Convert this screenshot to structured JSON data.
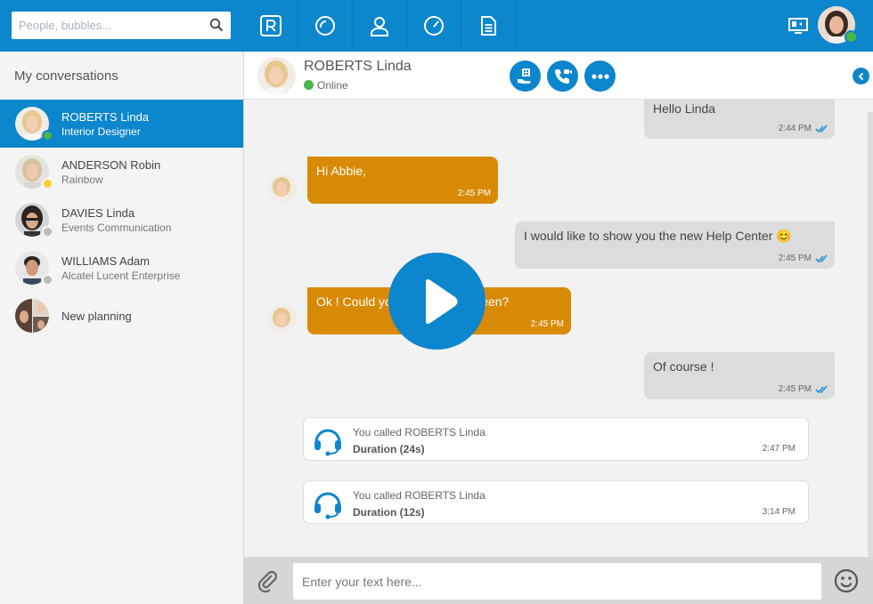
{
  "search": {
    "placeholder": "People, bubbles..."
  },
  "nav": [
    {
      "id": "rainbow",
      "icon": "rainbow-logo-icon"
    },
    {
      "id": "history",
      "icon": "circle-arc-icon"
    },
    {
      "id": "contacts",
      "icon": "person-icon"
    },
    {
      "id": "dashboard",
      "icon": "gauge-icon"
    },
    {
      "id": "documents",
      "icon": "document-icon"
    }
  ],
  "sidebar": {
    "title": "My conversations",
    "conversations": [
      {
        "name": "ROBERTS Linda",
        "subtitle": "Interior Designer",
        "status": "online",
        "status_color": "#48b648",
        "active": true
      },
      {
        "name": "ANDERSON Robin",
        "subtitle": "Rainbow",
        "status": "away",
        "status_color": "#f5d02e",
        "active": false
      },
      {
        "name": "DAVIES Linda",
        "subtitle": "Events Communication",
        "status": "offline",
        "status_color": "#bbbbbb",
        "active": false
      },
      {
        "name": "WILLIAMS Adam",
        "subtitle": "Alcatel Lucent Enterprise",
        "status": "offline",
        "status_color": "#bbbbbb",
        "active": false
      },
      {
        "name": "New planning",
        "subtitle": "",
        "status": "group",
        "active": false
      }
    ]
  },
  "chat": {
    "contact_name": "ROBERTS Linda",
    "contact_status": "Online",
    "messages": [
      {
        "dir": "out",
        "text": "Hello Linda",
        "time": "2:44 PM"
      },
      {
        "dir": "in",
        "text": "Hi Abbie,",
        "time": "2:45 PM"
      },
      {
        "dir": "out",
        "text": "I would like to show you the new Help Center 😊",
        "time": "2:45 PM"
      },
      {
        "dir": "in",
        "text": "Ok ! Could you share your screen?",
        "time": "2:45 PM"
      },
      {
        "dir": "out",
        "text": "Of course !",
        "time": "2:45 PM"
      }
    ],
    "calls": [
      {
        "text": "You called ROBERTS Linda",
        "duration": "Duration (24s)",
        "time": "2:47 PM"
      },
      {
        "text": "You called ROBERTS Linda",
        "duration": "Duration (12s)",
        "time": "3:14 PM"
      }
    ]
  },
  "composer": {
    "placeholder": "Enter your text here..."
  },
  "colors": {
    "brand": "#0c86cc",
    "incoming": "#d88a06",
    "outgoing": "#dcdcdc"
  }
}
